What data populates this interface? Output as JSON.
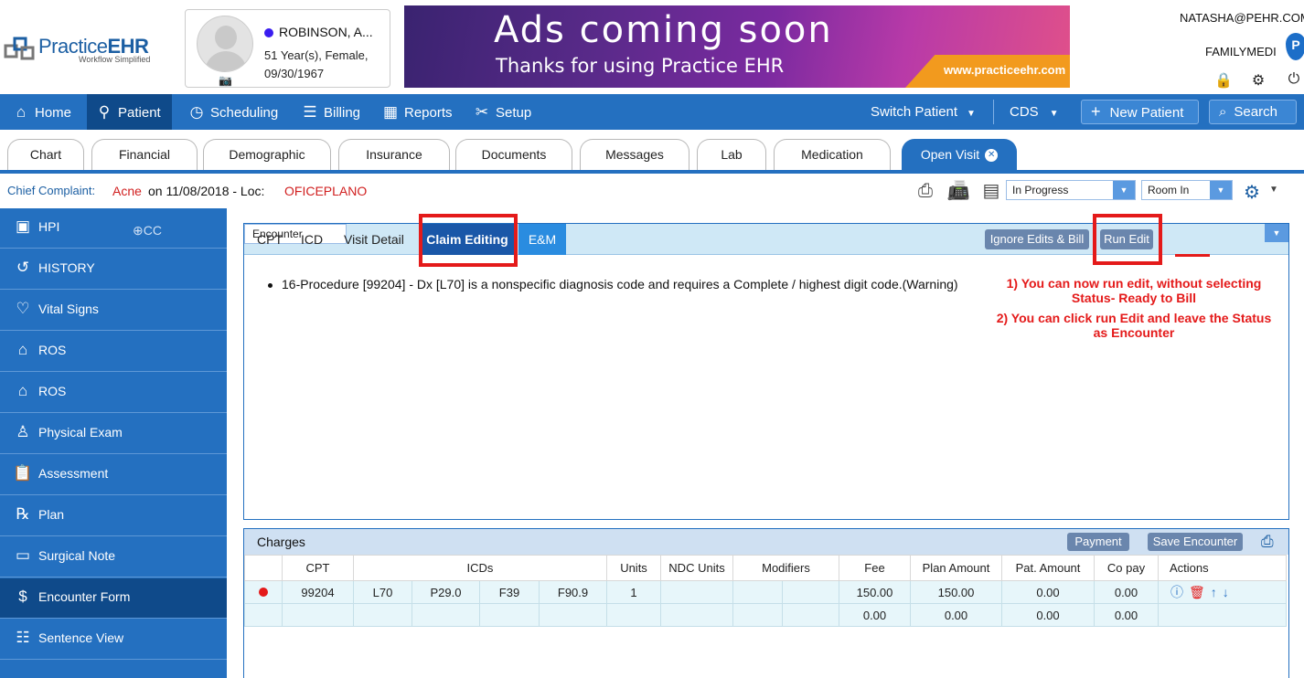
{
  "header": {
    "logo": {
      "brand_plain": "Practice",
      "brand_bold": "EHR",
      "tagline": "Workflow Simplified"
    },
    "patient": {
      "name": "ROBINSON, A...",
      "age_gender": "51 Year(s), Female,",
      "dob": "09/30/1967"
    },
    "ad": {
      "headline": "Ads coming soon",
      "subline": "Thanks for using Practice EHR",
      "url": "www.practiceehr.com"
    },
    "user": {
      "email": "NATASHA@PEHR.COM",
      "org": "FAMILYMEDI",
      "badge": "P"
    }
  },
  "nav": {
    "home": "Home",
    "patient": "Patient",
    "scheduling": "Scheduling",
    "billing": "Billing",
    "reports": "Reports",
    "setup": "Setup",
    "switch_patient": "Switch Patient",
    "cds": "CDS",
    "new_patient": "New Patient",
    "search": "Search"
  },
  "tabs": [
    "Chart",
    "Financial",
    "Demographic",
    "Insurance",
    "Documents",
    "Messages",
    "Lab",
    "Medication",
    "Open Visit"
  ],
  "complaint": {
    "label": "Chief Complaint:",
    "value": "Acne",
    "on_text": "on 11/08/2018 - Loc:",
    "location": "OFICEPLANO",
    "status": "In Progress",
    "room": "Room In"
  },
  "sidebar": {
    "cc": "CC",
    "items": [
      "HPI",
      "HISTORY",
      "Vital Signs",
      "ROS",
      "ROS",
      "Physical Exam",
      "Assessment",
      "Plan",
      "Surgical Note",
      "Encounter Form",
      "Sentence View"
    ]
  },
  "claim": {
    "tabs": [
      "CPT",
      "ICD",
      "Visit Detail",
      "Claim Editing",
      "E&M"
    ],
    "ignore_btn": "Ignore Edits & Bill",
    "run_btn": "Run Edit",
    "encounter_select": "Encounter",
    "warning": "16-Procedure [99204] - Dx [L70] is a nonspecific diagnosis code and requires a Complete / highest digit code.(Warning)",
    "note1_line1": "1) You can now run edit, without selecting",
    "note1_line2": "Status- Ready to Bill",
    "note2_line1": "2) You can click run Edit and leave the Status",
    "note2_line2": "as Encounter"
  },
  "charges": {
    "title": "Charges",
    "payment_btn": "Payment",
    "save_btn": "Save Encounter",
    "columns": [
      "CPT",
      "ICDs",
      "Units",
      "NDC Units",
      "Modifiers",
      "Fee",
      "Plan Amount",
      "Pat. Amount",
      "Co pay",
      "Actions"
    ],
    "row1": {
      "cpt": "99204",
      "icd1": "L70",
      "icd2": "P29.0",
      "icd3": "F39",
      "icd4": "F90.9",
      "units": "1",
      "fee": "150.00",
      "plan": "150.00",
      "pat": "0.00",
      "copay": "0.00"
    },
    "row2": {
      "fee": "0.00",
      "plan": "0.00",
      "pat": "0.00",
      "copay": "0.00"
    }
  },
  "colors": {
    "nav_blue": "#2470c0",
    "active_blue": "#0f4a8a",
    "annotation_red": "#e41a1a",
    "alert_red": "#d12020"
  }
}
